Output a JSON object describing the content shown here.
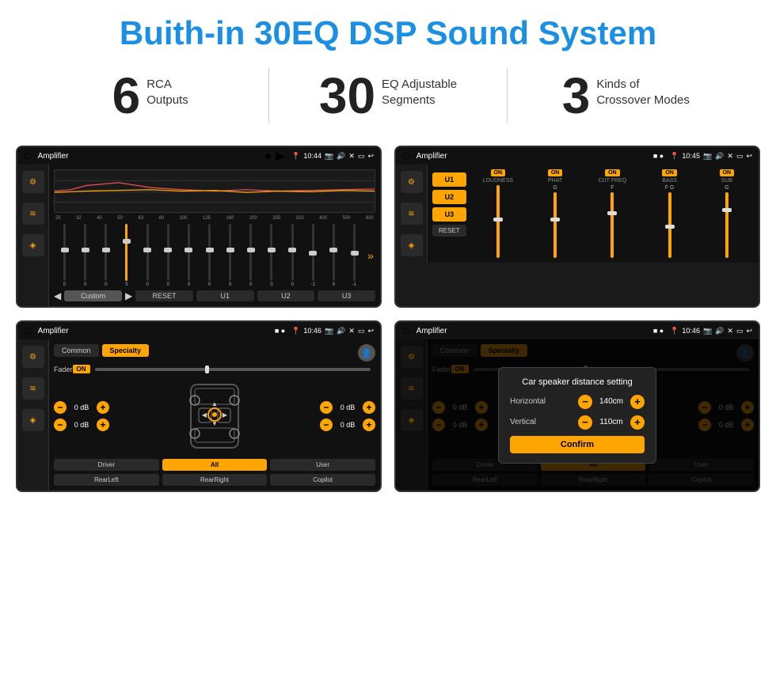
{
  "page": {
    "title": "Buith-in 30EQ DSP Sound System",
    "stats": [
      {
        "number": "6",
        "text_line1": "RCA",
        "text_line2": "Outputs"
      },
      {
        "number": "30",
        "text_line1": "EQ Adjustable",
        "text_line2": "Segments"
      },
      {
        "number": "3",
        "text_line1": "Kinds of",
        "text_line2": "Crossover Modes"
      }
    ]
  },
  "screens": {
    "eq": {
      "status_time": "10:44",
      "app_title": "Amplifier",
      "freqs": [
        "25",
        "32",
        "40",
        "50",
        "63",
        "80",
        "100",
        "125",
        "160",
        "200",
        "250",
        "320",
        "400",
        "500",
        "630"
      ],
      "values": [
        "0",
        "0",
        "0",
        "5",
        "0",
        "0",
        "0",
        "0",
        "0",
        "0",
        "0",
        "0",
        "-1",
        "0",
        "-1"
      ],
      "nav_labels": [
        "Custom",
        "RESET",
        "U1",
        "U2",
        "U3"
      ]
    },
    "crossover": {
      "status_time": "10:45",
      "app_title": "Amplifier",
      "presets": [
        "U1",
        "U2",
        "U3"
      ],
      "channels": [
        {
          "label": "LOUDNESS",
          "on": true
        },
        {
          "label": "PHAT",
          "on": true
        },
        {
          "label": "CUT FREQ",
          "on": true
        },
        {
          "label": "BASS",
          "on": true
        },
        {
          "label": "SUB",
          "on": true
        }
      ],
      "reset_label": "RESET"
    },
    "fader": {
      "status_time": "10:46",
      "app_title": "Amplifier",
      "tabs": [
        "Common",
        "Specialty"
      ],
      "fader_label": "Fader",
      "fader_on": "ON",
      "vol_values": [
        "0 dB",
        "0 dB",
        "0 dB",
        "0 dB"
      ],
      "bottom_btns": [
        "Driver",
        "RearLeft",
        "All",
        "User",
        "RearRight",
        "Copilot"
      ]
    },
    "dialog": {
      "status_time": "10:46",
      "app_title": "Amplifier",
      "dialog_title": "Car speaker distance setting",
      "horizontal_label": "Horizontal",
      "horizontal_value": "140cm",
      "vertical_label": "Vertical",
      "vertical_value": "110cm",
      "confirm_label": "Confirm",
      "vol_right_values": [
        "0 dB",
        "0 dB"
      ],
      "bottom_btns": [
        "Driver",
        "RearLeft",
        "All",
        "User",
        "RearRight",
        "Copilot"
      ]
    }
  },
  "icons": {
    "home": "⌂",
    "back": "↩",
    "location_pin": "📍",
    "speaker": "🔊",
    "close_x": "✕",
    "window": "▭",
    "equalizer": "≡",
    "music_wave": "♫",
    "speaker_icon": "◈",
    "up_arrow": "▲",
    "down_arrow": "▼",
    "left_arrow": "◀",
    "right_arrow": "▶",
    "double_right": "»",
    "minus": "−",
    "plus": "+"
  }
}
